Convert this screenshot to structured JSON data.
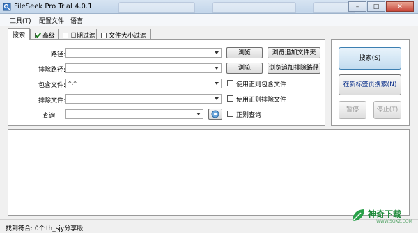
{
  "window": {
    "title": "FileSeek Pro Trial 4.0.1"
  },
  "menu": {
    "items": [
      "工具(T)",
      "配置文件",
      "语言"
    ]
  },
  "tabs": [
    {
      "label": "搜索",
      "active": true,
      "checkbox": null
    },
    {
      "label": "高级",
      "active": false,
      "checkbox": "checked"
    },
    {
      "label": "日期过滤",
      "active": false,
      "checkbox": "unchecked"
    },
    {
      "label": "文件大小过滤",
      "active": false,
      "checkbox": "unchecked"
    }
  ],
  "form": {
    "path_label": "路径:",
    "path_value": "",
    "exclude_path_label": "排除路径:",
    "exclude_path_value": "",
    "include_files_label": "包含文件:",
    "include_files_value": "*.*",
    "exclude_files_label": "排除文件:",
    "exclude_files_value": "",
    "query_label": "查询:",
    "query_value": ""
  },
  "buttons": {
    "browse": "浏览",
    "browse2": "浏览",
    "browse_add_folder": "浏览追加文件夹",
    "browse_add_exclude": "浏览追加排除路径",
    "search": "搜索(S)",
    "search_new_tab": "在新标签页搜索(N)",
    "pause": "暂停",
    "stop": "停止(T)"
  },
  "checkboxes": {
    "regex_include": "使用正则包含文件",
    "regex_exclude": "使用正则排除文件",
    "regex_query": "正则查询"
  },
  "status": {
    "found": "找到符合: 0个",
    "share": "th_sjy分享版"
  },
  "watermark": {
    "text": "神奇下载",
    "sub": "WWW.SQXZ.COM"
  },
  "colors": {
    "accent": "#3c7fb1",
    "link": "#0a2f8a",
    "watermark": "#1e8a3a"
  }
}
